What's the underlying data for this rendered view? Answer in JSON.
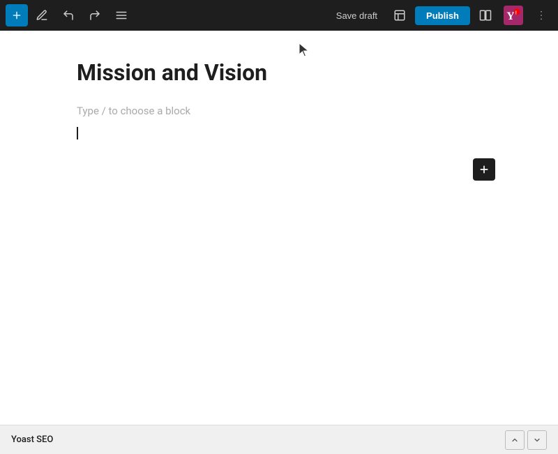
{
  "toolbar": {
    "add_label": "+",
    "save_draft_label": "Save draft",
    "publish_label": "Publish"
  },
  "editor": {
    "title": "Mission and Vision",
    "block_placeholder": "Type / to choose a block"
  },
  "bottom_bar": {
    "label": "Yoast SEO"
  }
}
